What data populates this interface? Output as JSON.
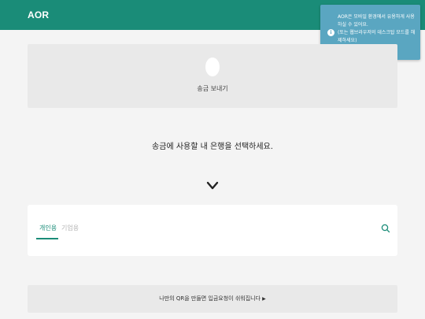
{
  "app": {
    "brand": "AOR"
  },
  "toast": {
    "icon": "info-icon",
    "icon_glyph": "i",
    "message": "AOR은 모바일 환경에서 유용하게 사용\n하실 수 있어요.\n(또는 웹브라우저의 데스크탑 모드를 해\n제하세요)"
  },
  "send_card": {
    "label": "송금 보내기"
  },
  "prompt": "송금에 사용할 내 은행을 선택하세요.",
  "bank_select": {
    "tabs": [
      {
        "label": "개인용",
        "active": true
      },
      {
        "label": "기업용",
        "active": false
      }
    ],
    "search_icon": "search-icon"
  },
  "qr_banner": {
    "text": "나만의 QR을 만들면 입금요청이 쉬워집니다",
    "arrow": "▶"
  },
  "colors": {
    "primary": "#1a8c78",
    "toast": "#5aa6c1",
    "card_grey": "#e9e9e9",
    "page_bg": "#f4f4f4"
  }
}
